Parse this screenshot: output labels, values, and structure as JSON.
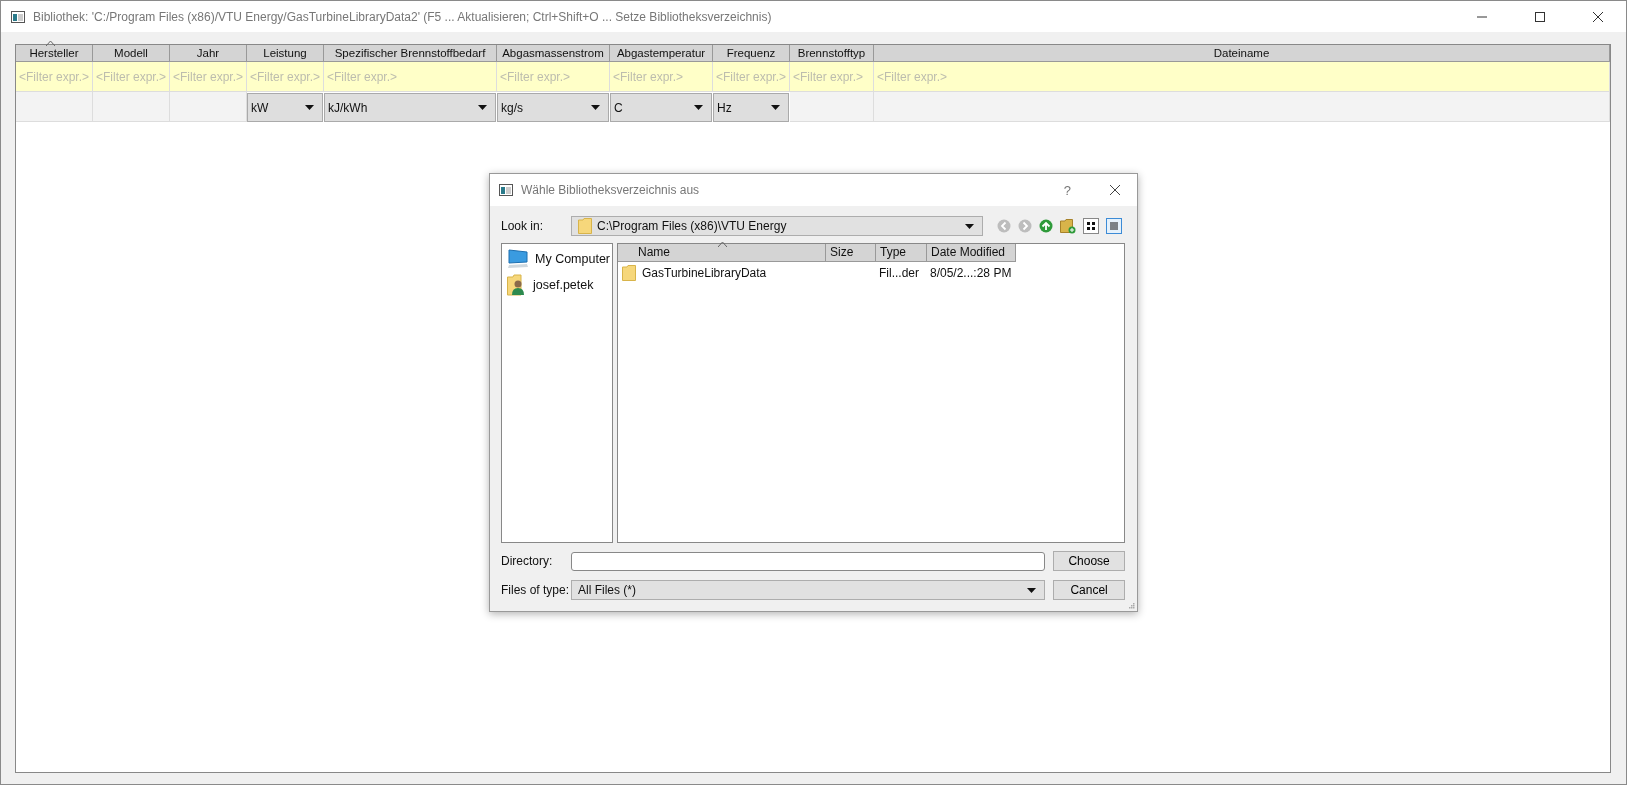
{
  "window": {
    "title": "Bibliothek: 'C:/Program Files (x86)/VTU Energy/GasTurbineLibraryData2' (F5 ... Aktualisieren; Ctrl+Shift+O ... Setze Bibliotheksverzeichnis)"
  },
  "table": {
    "columns": [
      {
        "label": "Hersteller",
        "sorted": true,
        "filter_placeholder": "<Filter expr.>"
      },
      {
        "label": "Modell",
        "sorted": false,
        "filter_placeholder": "<Filter expr.>"
      },
      {
        "label": "Jahr",
        "sorted": false,
        "filter_placeholder": "<Filter expr.>"
      },
      {
        "label": "Leistung",
        "sorted": false,
        "filter_placeholder": "<Filter expr.>",
        "unit": "kW"
      },
      {
        "label": "Spezifischer Brennstoffbedarf",
        "sorted": false,
        "filter_placeholder": "<Filter expr.>",
        "unit": "kJ/kWh"
      },
      {
        "label": "Abgasmassenstrom",
        "sorted": false,
        "filter_placeholder": "<Filter expr.>",
        "unit": "kg/s"
      },
      {
        "label": "Abgastemperatur",
        "sorted": false,
        "filter_placeholder": "<Filter expr.>",
        "unit": "C"
      },
      {
        "label": "Frequenz",
        "sorted": false,
        "filter_placeholder": "<Filter expr.>",
        "unit": "Hz"
      },
      {
        "label": "Brennstofftyp",
        "sorted": false,
        "filter_placeholder": "<Filter expr.>"
      },
      {
        "label": "Dateiname",
        "sorted": false,
        "filter_placeholder": "<Filter expr.>"
      }
    ]
  },
  "dialog": {
    "title": "Wähle Bibliotheksverzeichnis aus",
    "help": "?",
    "look_in": {
      "label": "Look in:",
      "value": "C:\\Program Files (x86)\\VTU Energy"
    },
    "places": [
      {
        "label": "My Computer",
        "kind": "computer"
      },
      {
        "label": "josef.petek",
        "kind": "user"
      }
    ],
    "files": {
      "columns": [
        {
          "label": "Name",
          "sorted": true
        },
        {
          "label": "Size",
          "sorted": false
        },
        {
          "label": "Type",
          "sorted": false
        },
        {
          "label": "Date Modified",
          "sorted": false
        }
      ],
      "rows": [
        {
          "name": "GasTurbineLibraryData",
          "type": "Fil...der",
          "date": "8/05/2...:28 PM"
        }
      ]
    },
    "directory": {
      "label": "Directory:"
    },
    "files_of_type": {
      "label": "Files of type:",
      "value": "All Files (*)"
    },
    "buttons": [
      "Choose",
      "Cancel"
    ]
  }
}
